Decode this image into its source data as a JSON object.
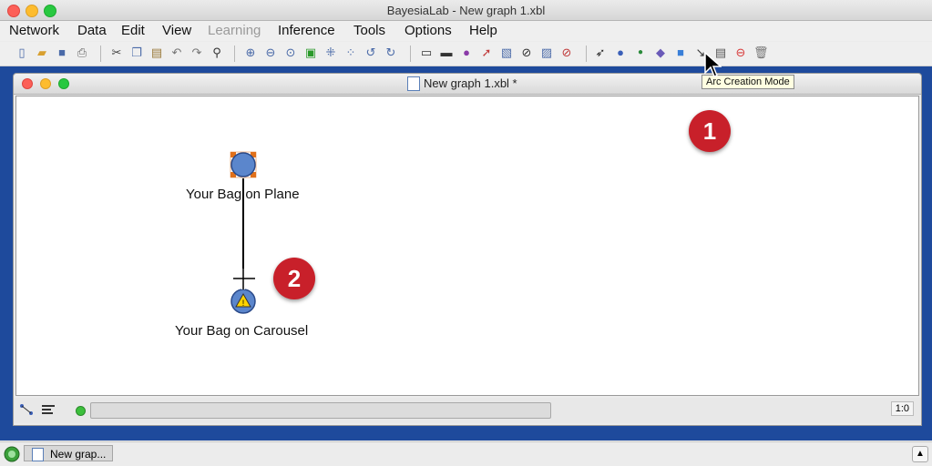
{
  "app": {
    "title": "BayesiaLab - New graph 1.xbl"
  },
  "menubar": {
    "items": [
      {
        "label": "Network",
        "enabled": true
      },
      {
        "label": "Data",
        "enabled": true
      },
      {
        "label": "Edit",
        "enabled": true
      },
      {
        "label": "View",
        "enabled": true
      },
      {
        "label": "Learning",
        "enabled": false
      },
      {
        "label": "Inference",
        "enabled": true
      },
      {
        "label": "Tools",
        "enabled": true
      },
      {
        "label": "Options",
        "enabled": true
      },
      {
        "label": "Help",
        "enabled": true
      }
    ]
  },
  "toolbar": {
    "icons": [
      "new-file-icon",
      "open-folder-icon",
      "save-icon",
      "print-icon",
      "cut-icon",
      "copy-icon",
      "paste-icon",
      "undo-icon",
      "redo-icon",
      "find-icon",
      "zoom-in-icon",
      "zoom-out-icon",
      "zoom-fit-icon",
      "fit-window-icon",
      "distribute-icon",
      "rotate-left-icon",
      "rotate-right-icon",
      "node-display-icon",
      "arc-display-icon",
      "color-icon",
      "pointer-tool-icon",
      "image-icon",
      "no-search-icon",
      "layout-icon",
      "no-entry-icon",
      "selection-mode-icon",
      "node-creation-icon",
      "small-node-icon",
      "decision-node-icon",
      "utility-node-icon",
      "arc-creation-icon",
      "note-icon",
      "delete-icon",
      "trash-icon"
    ],
    "tooltip": "Arc Creation Mode"
  },
  "document": {
    "title": "New graph 1.xbl *",
    "nodes": [
      {
        "label": "Your Bag on Plane",
        "state": "selected"
      },
      {
        "label": "Your Bag on Carousel",
        "state": "warning"
      }
    ],
    "callouts": [
      "1",
      "2"
    ]
  },
  "status": {
    "zoom": "1:0"
  },
  "taskbar": {
    "window_label": "New grap..."
  },
  "colors": {
    "desktop": "#1e4a9c",
    "node": "#5b86cc",
    "callout": "#c8202a"
  }
}
